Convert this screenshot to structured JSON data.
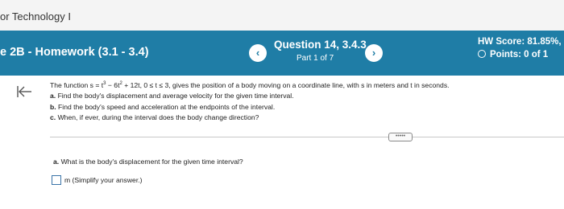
{
  "top_bar": {
    "title": "or Technology I"
  },
  "header": {
    "homework_name": "e 2B - Homework (3.1 - 3.4)",
    "prev_symbol": "‹",
    "next_symbol": "›",
    "question_title": "Question 14, 3.4.3",
    "part_label": "Part 1 of 7",
    "hw_score": "HW Score: 81.85%, 1",
    "points": "Points: 0 of 1"
  },
  "problem": {
    "intro_prefix": "The function s = t",
    "exp3": "3",
    "intro_mid": " − 6t",
    "exp2": "2",
    "intro_suffix": " + 12t, 0 ≤ t ≤ 3, gives the position of a body moving on a coordinate line, with s in meters and t in seconds.",
    "items": [
      {
        "label": "a.",
        "text": "Find the body's displacement and average velocity for the given time interval."
      },
      {
        "label": "b.",
        "text": "Find the body's speed and acceleration at the endpoints of the interval."
      },
      {
        "label": "c.",
        "text": "When, if ever, during the interval does the body change direction?"
      }
    ]
  },
  "more_button": {
    "label": "•••••"
  },
  "part_a": {
    "label": "a.",
    "question": "What is the body's displacement for the given time interval?",
    "unit_note": "m (Simplify your answer.)"
  }
}
